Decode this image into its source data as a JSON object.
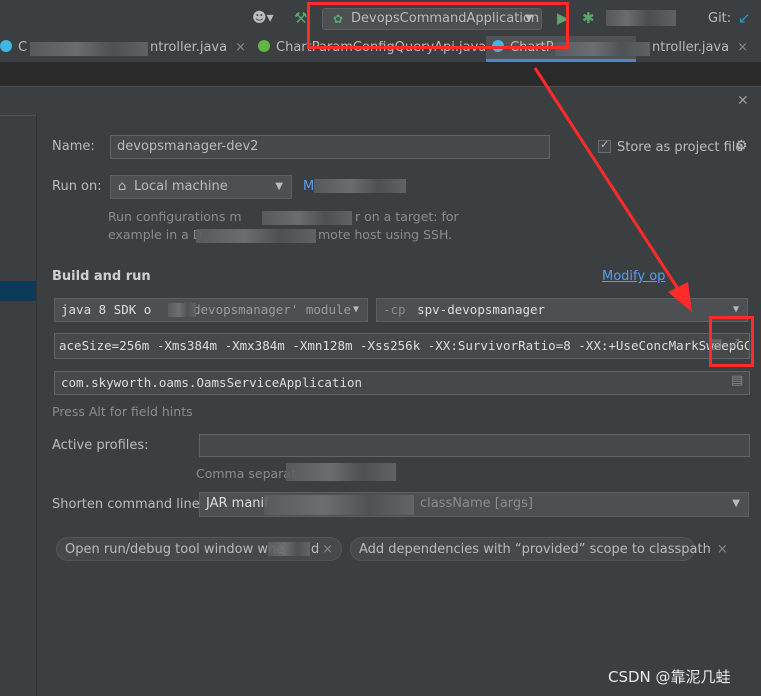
{
  "toolbar": {
    "run_config": "DevopsCommandApplication",
    "git_label": "Git:"
  },
  "tabs": [
    {
      "label": "C",
      "icon": "class-icon"
    },
    {
      "label": "ntroller.java"
    },
    {
      "label": "ChartParamConfigQueryApi.java",
      "icon": "interface-icon"
    },
    {
      "label": "ChartP",
      "icon": "class-icon"
    },
    {
      "label": "ntroller.java"
    }
  ],
  "dialog": {
    "name_label": "Name:",
    "name_value": "devopsmanager-dev2",
    "store_label": "Store as project file",
    "run_on_label": "Run on:",
    "run_on_value": "Local machine",
    "run_on_link": "M",
    "run_on_hint_1": "Run configurations m",
    "run_on_hint_1b": "r on a target: for",
    "run_on_hint_2": "example in a D",
    "run_on_hint_2b": "mote host using SSH.",
    "build_run_title": "Build and run",
    "modify_options": "Modify op",
    "jdk_value": "java 8 SDK o",
    "jdk_value_b": "devopsmanager' module",
    "cp_prefix": "-cp",
    "cp_value": "spv-devopsmanager",
    "vm_options": "aceSize=256m -Xms384m -Xmx384m -Xmn128m -Xss256k -XX:SurvivorRatio=8 -XX:+UseConcMarkSweepGC",
    "main_class": "com.skyworth.oams.OamsServiceApplication",
    "field_hint": "Press Alt for field hints",
    "active_profiles_label": "Active profiles:",
    "active_profiles_value": "",
    "profiles_hint": "Comma separat",
    "shorten_label": "Shorten command line:",
    "shorten_value": "JAR manif",
    "shorten_value_b": "className [args]",
    "chip_1": "Open run/debug tool window whe",
    "chip_1b": "d",
    "chip_2": "Add dependencies with “provided” scope to classpath"
  },
  "watermark": "CSDN @靠泥几蛙",
  "colors": {
    "background": "#3c3f41",
    "accent_link": "#589df6",
    "highlight": "#ff2a2a"
  }
}
